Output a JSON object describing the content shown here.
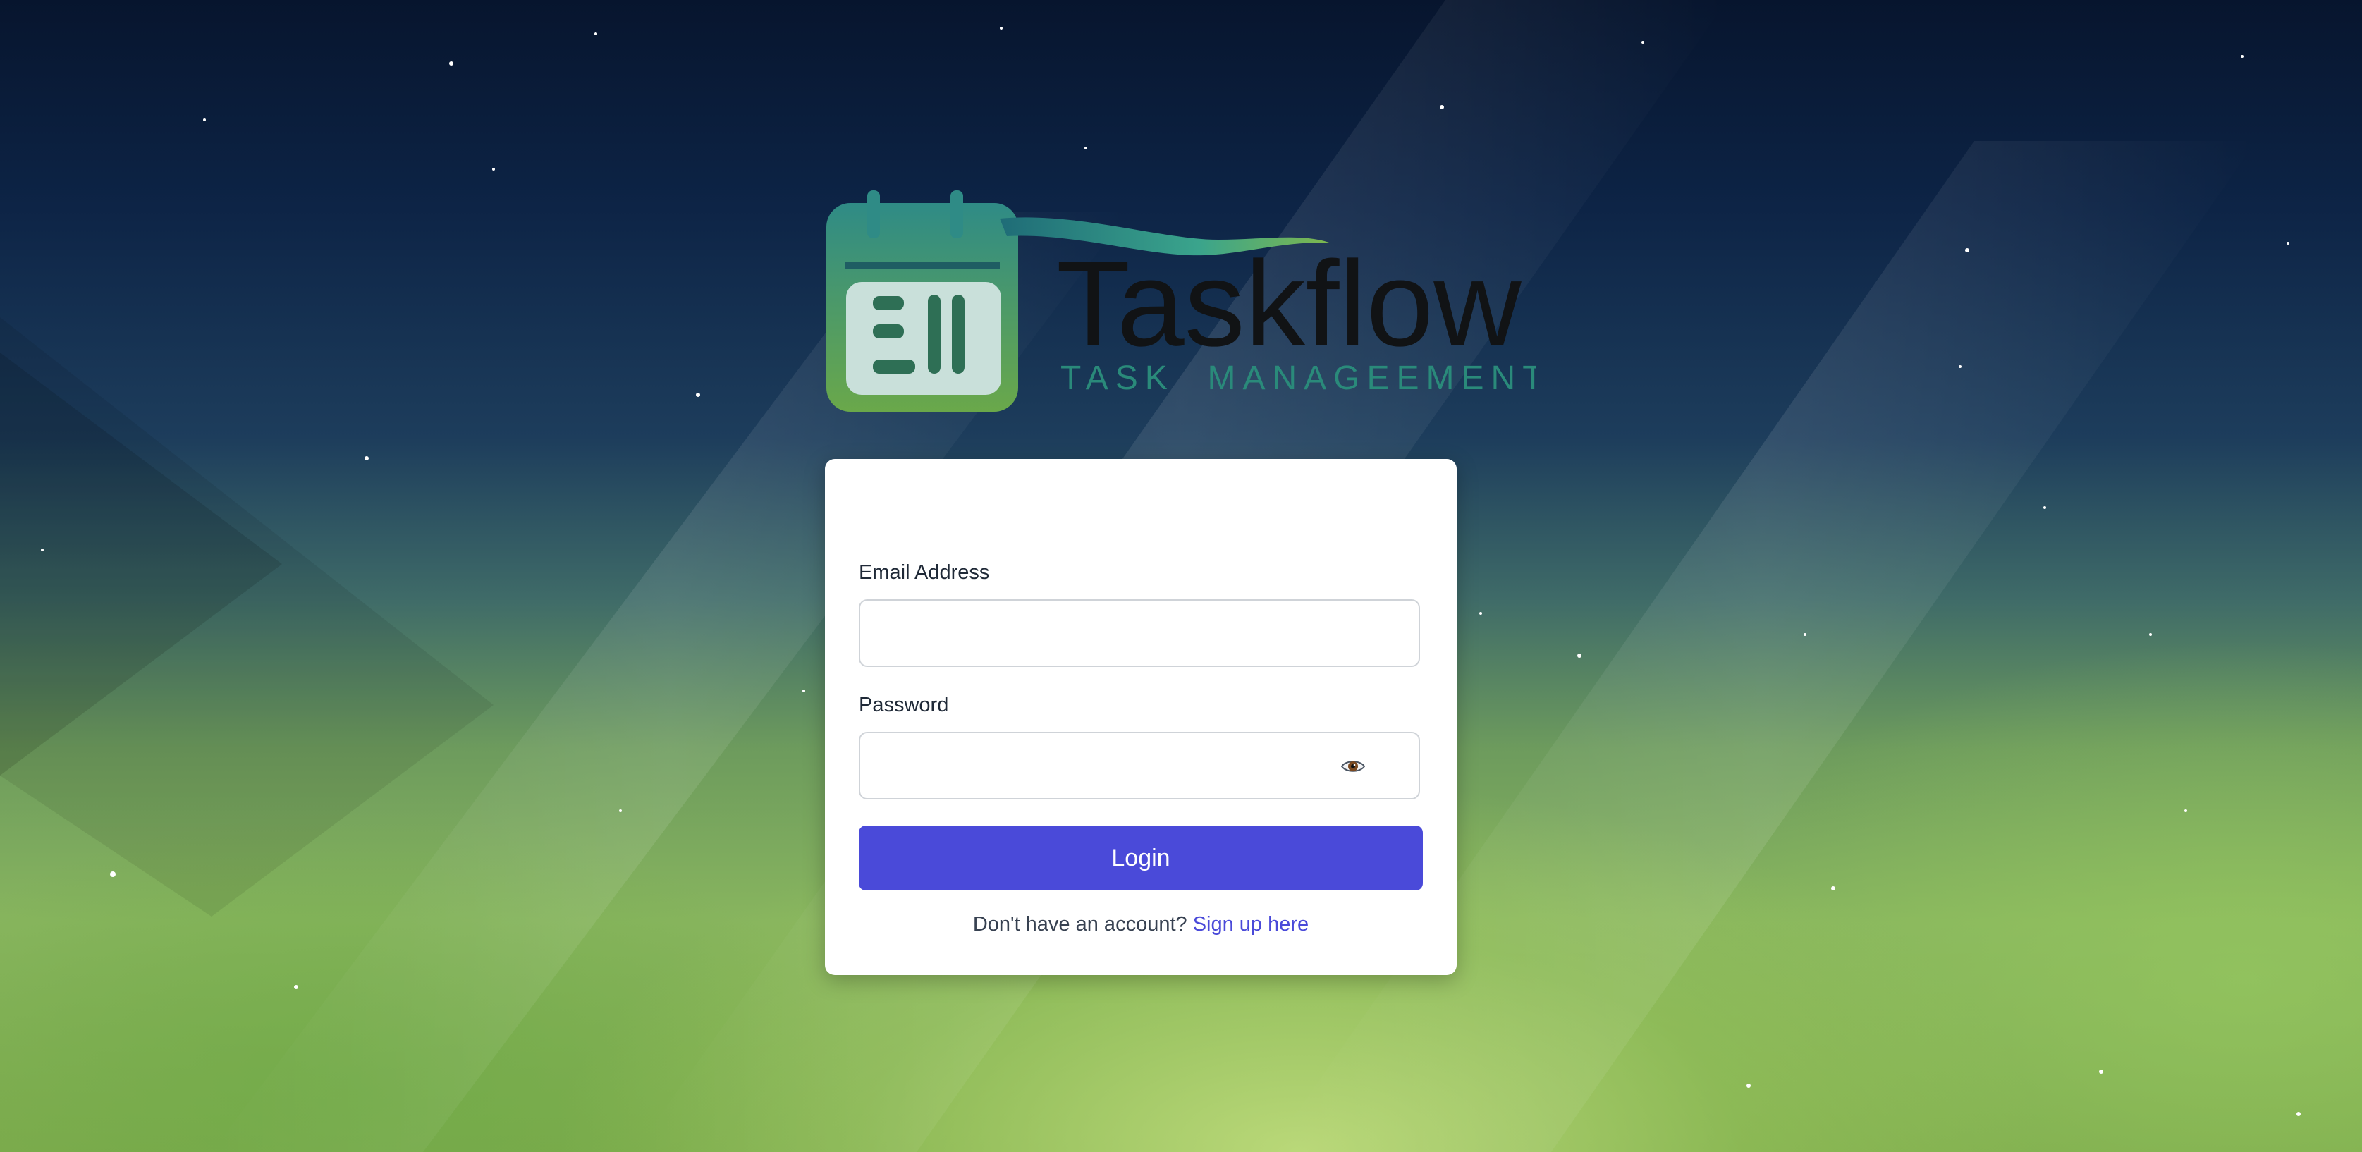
{
  "brand": {
    "name": "Taskflow",
    "tagline": "TASK  MANAGEEMENT"
  },
  "form": {
    "email_label": "Email Address",
    "email_value": "",
    "password_label": "Password",
    "password_value": "",
    "login_label": "Login"
  },
  "signup": {
    "prompt": "Don't have an account?",
    "link_label": "Sign up here"
  },
  "icons": {
    "password_toggle": "eye-icon",
    "logo": "calendar-icon"
  },
  "colors": {
    "accent": "#4a4ad9",
    "brand_teal": "#2a8a7a",
    "brand_green": "#5a9a48"
  }
}
